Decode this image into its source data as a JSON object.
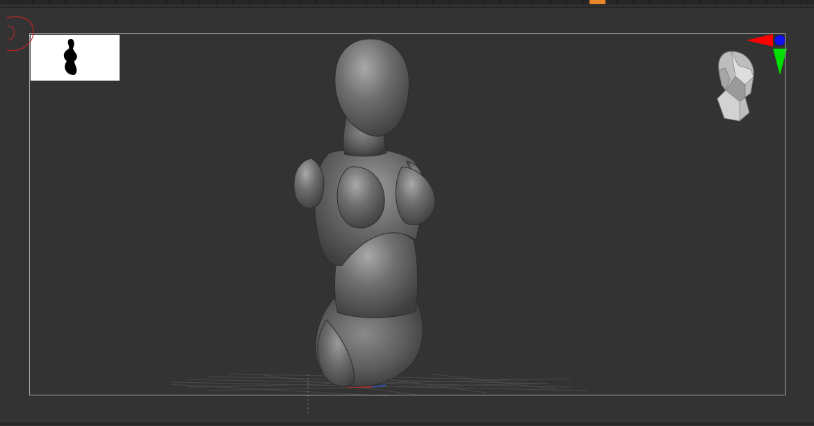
{
  "window": {
    "title": ""
  },
  "viewport": {
    "model": "female-mannequin-torso",
    "background": "#333333",
    "frame_border": "#a8a8a8"
  },
  "navigator": {
    "icon": "head-navigation-icon",
    "x_axis_color": "#ff0000",
    "y_axis_color": "#00ff00",
    "z_axis_color": "#0000ff"
  },
  "thumbnail": {
    "icon": "silhouette-thumbnail-icon",
    "background": "#ffffff"
  },
  "toolbar": {
    "active_segment_color": "#e8862a"
  }
}
